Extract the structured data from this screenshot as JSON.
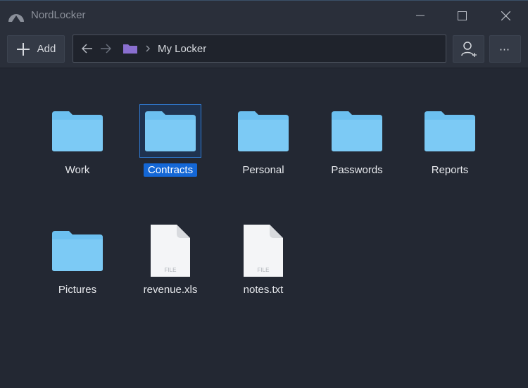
{
  "window": {
    "title": "NordLocker"
  },
  "toolbar": {
    "add_label": "Add",
    "breadcrumb": "My Locker"
  },
  "items": [
    {
      "name": "Work",
      "type": "folder"
    },
    {
      "name": "Contracts",
      "type": "folder",
      "selected": true
    },
    {
      "name": "Personal",
      "type": "folder"
    },
    {
      "name": "Passwords",
      "type": "folder"
    },
    {
      "name": "Reports",
      "type": "folder"
    },
    {
      "name": "Pictures",
      "type": "folder"
    },
    {
      "name": "revenue.xls",
      "type": "file",
      "badge": "FILE"
    },
    {
      "name": "notes.txt",
      "type": "file",
      "badge": "FILE"
    }
  ],
  "colors": {
    "folder": "#6cc0f0",
    "selection": "#1467d6",
    "breadcrumb_folder": "#8a6fd0"
  }
}
